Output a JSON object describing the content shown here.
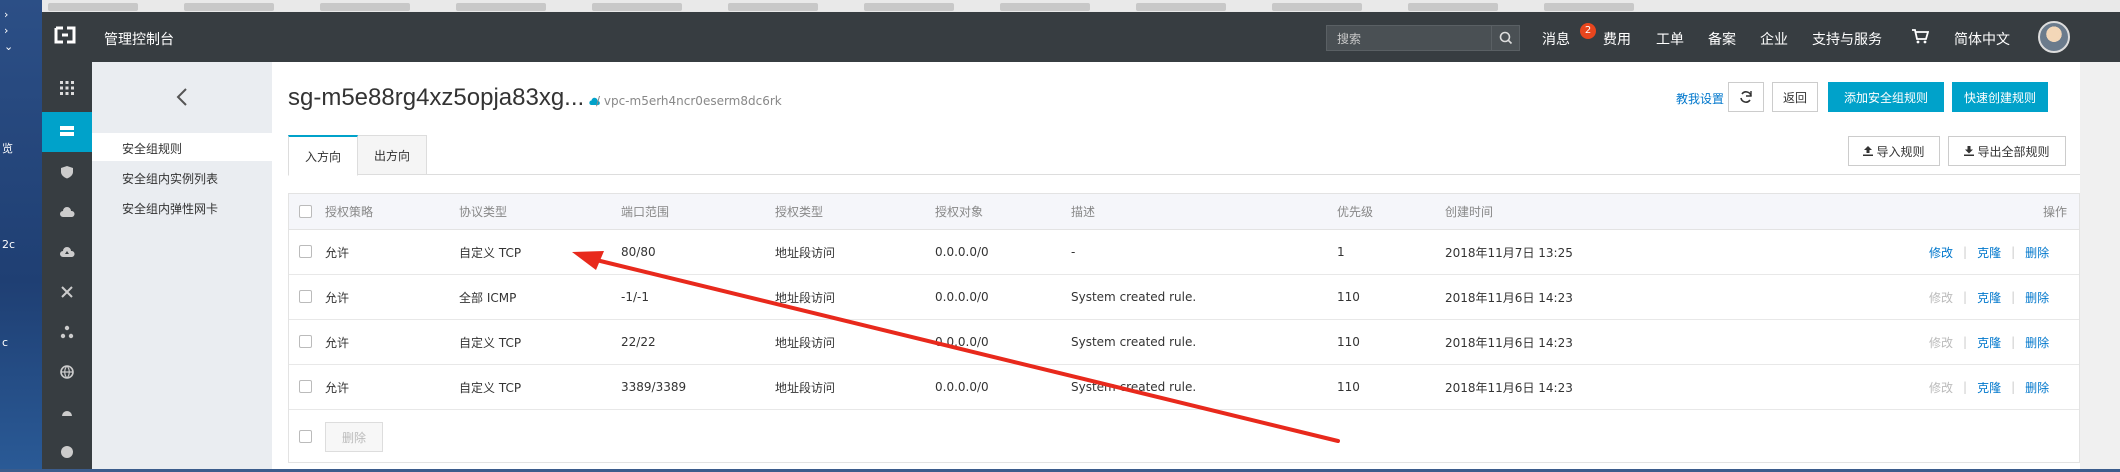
{
  "desktop": {
    "labels": [
      "览",
      "2c",
      "c"
    ]
  },
  "topnav": {
    "console_title": "管理控制台",
    "search_placeholder": "搜索",
    "badge_count": "2",
    "items": [
      "消息",
      "费用",
      "工单",
      "备案",
      "企业",
      "支持与服务",
      "简体中文"
    ]
  },
  "submenu": {
    "items": [
      "安全组规则",
      "安全组内实例列表",
      "安全组内弹性网卡"
    ]
  },
  "header": {
    "title": "sg-m5e88rg4xz5opja83xg...",
    "vpc": "/ vpc-m5erh4ncr0eserm8dc6rk",
    "help": "教我设置",
    "back_label": "返回",
    "add_rule_label": "添加安全组规则",
    "quick_create_label": "快速创建规则"
  },
  "tabs": {
    "inbound": "入方向",
    "outbound": "出方向"
  },
  "toolbar": {
    "import_label": "导入规则",
    "export_label": "导出全部规则"
  },
  "table": {
    "headers": {
      "policy": "授权策略",
      "protocol": "协议类型",
      "port": "端口范围",
      "auth_type": "授权类型",
      "auth_object": "授权对象",
      "desc": "描述",
      "priority": "优先级",
      "created": "创建时间",
      "ops": "操作"
    },
    "rows": [
      {
        "policy": "允许",
        "protocol": "自定义 TCP",
        "port": "80/80",
        "auth_type": "地址段访问",
        "auth_object": "0.0.0.0/0",
        "desc": "-",
        "priority": "1",
        "created": "2018年11月7日 13:25",
        "modify": "修改",
        "clone": "克隆",
        "delete": "删除"
      },
      {
        "policy": "允许",
        "protocol": "全部 ICMP",
        "port": "-1/-1",
        "auth_type": "地址段访问",
        "auth_object": "0.0.0.0/0",
        "desc": "System created rule.",
        "priority": "110",
        "created": "2018年11月6日 14:23",
        "modify": "修改",
        "clone": "克隆",
        "delete": "删除"
      },
      {
        "policy": "允许",
        "protocol": "自定义 TCP",
        "port": "22/22",
        "auth_type": "地址段访问",
        "auth_object": "0.0.0.0/0",
        "desc": "System created rule.",
        "priority": "110",
        "created": "2018年11月6日 14:23",
        "modify": "修改",
        "clone": "克隆",
        "delete": "删除"
      },
      {
        "policy": "允许",
        "protocol": "自定义 TCP",
        "port": "3389/3389",
        "auth_type": "地址段访问",
        "auth_object": "0.0.0.0/0",
        "desc": "System created rule.",
        "priority": "110",
        "created": "2018年11月6日 14:23",
        "modify": "修改",
        "clone": "克隆",
        "delete": "删除"
      }
    ],
    "delete_label": "删除"
  },
  "colors": {
    "accent": "#00a2ca",
    "nav_bg": "#373d41",
    "link": "#0077cc",
    "annotation": "#e8291c"
  }
}
